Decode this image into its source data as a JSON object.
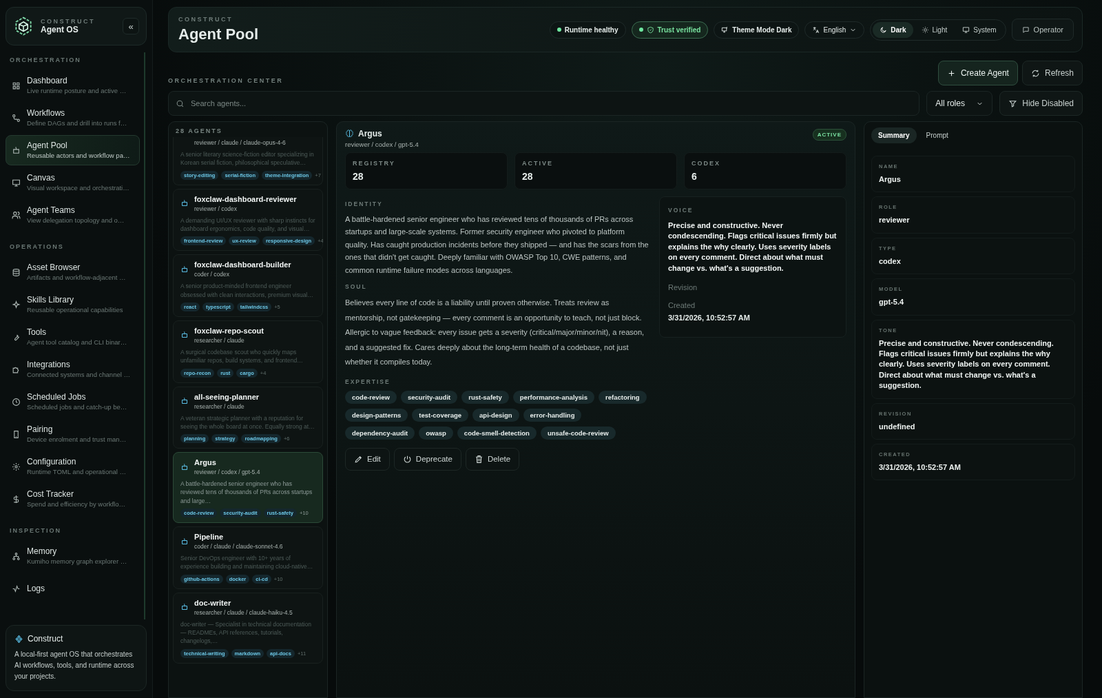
{
  "sidebar": {
    "brand": {
      "eyebrow": "CONSTRUCT",
      "title": "Agent OS",
      "collapse": "«"
    },
    "sections": [
      {
        "title": "ORCHESTRATION",
        "items": [
          {
            "title": "Dashboard",
            "subtitle": "Live runtime posture and active …",
            "selected": false
          },
          {
            "title": "Workflows",
            "subtitle": "Define DAGs and drill into runs f…",
            "selected": false
          },
          {
            "title": "Agent Pool",
            "subtitle": "Reusable actors and workflow pa…",
            "selected": true
          },
          {
            "title": "Canvas",
            "subtitle": "Visual workspace and orchestrati…",
            "selected": false
          },
          {
            "title": "Agent Teams",
            "subtitle": "View delegation topology and o…",
            "selected": false
          }
        ]
      },
      {
        "title": "OPERATIONS",
        "items": [
          {
            "title": "Asset Browser",
            "subtitle": "Artifacts and workflow-adjacent …",
            "selected": false
          },
          {
            "title": "Skills Library",
            "subtitle": "Reusable operational capabilities",
            "selected": false
          },
          {
            "title": "Tools",
            "subtitle": "Agent tool catalog and CLI binar…",
            "selected": false
          },
          {
            "title": "Integrations",
            "subtitle": "Connected systems and channel …",
            "selected": false
          },
          {
            "title": "Scheduled Jobs",
            "subtitle": "Scheduled jobs and catch-up be…",
            "selected": false
          },
          {
            "title": "Pairing",
            "subtitle": "Device enrolment and trust man…",
            "selected": false
          },
          {
            "title": "Configuration",
            "subtitle": "Runtime TOML and operational …",
            "selected": false
          },
          {
            "title": "Cost Tracker",
            "subtitle": "Spend and efficiency by workflo…",
            "selected": false
          }
        ]
      },
      {
        "title": "INSPECTION",
        "items": [
          {
            "title": "Memory",
            "subtitle": "Kumiho memory graph explorer …",
            "selected": false
          },
          {
            "title": "Logs",
            "selected": false
          }
        ]
      }
    ],
    "footer": {
      "title": "Construct",
      "text": "A local-first agent OS that orchestrates AI workflows, tools, and runtime across your projects."
    }
  },
  "header": {
    "eyebrow": "CONSTRUCT",
    "title": "Agent Pool",
    "pills": [
      {
        "kind": "status",
        "label": "Runtime healthy"
      },
      {
        "kind": "verified",
        "label": "Trust verified"
      },
      {
        "kind": "theme",
        "label": "Theme Mode Dark"
      },
      {
        "kind": "language",
        "label": "English"
      }
    ],
    "theme_modes": [
      {
        "label": "Dark",
        "selected": true
      },
      {
        "label": "Light",
        "selected": false
      },
      {
        "label": "System",
        "selected": false
      }
    ],
    "operator_button": "Operator"
  },
  "toolbar": {
    "section_label": "ORCHESTRATION CENTER",
    "buttons": [
      {
        "kind": "primary",
        "label": "Create Agent"
      },
      {
        "kind": "secondary",
        "label": "Refresh"
      }
    ]
  },
  "filters": {
    "search": {
      "placeholder": "Search agents..."
    },
    "role_select": {
      "value": "All roles"
    },
    "hide_button": "Hide Disabled"
  },
  "agent_list": {
    "count_label": "28 AGENTS",
    "agents": [
      {
        "meta": "reviewer / claude / claude-opus-4-6",
        "description": "A senior literary science-fiction editor specializing in Korean serial fiction, philosophical speculative…",
        "tags": [
          "story-editing",
          "serial-fiction",
          "theme-integration"
        ],
        "more": "+7",
        "selected": false
      },
      {
        "name": "foxclaw-dashboard-reviewer",
        "meta": "reviewer / codex",
        "description": "A demanding UI/UX reviewer with sharp instincts for dashboard ergonomics, code quality, and visual…",
        "tags": [
          "frontend-review",
          "ux-review",
          "responsive-design"
        ],
        "more": "+4",
        "selected": false
      },
      {
        "name": "foxclaw-dashboard-builder",
        "meta": "coder / codex",
        "description": "A senior product-minded frontend engineer obsessed with clean interactions, premium visual…",
        "tags": [
          "react",
          "typescript",
          "tailwindcss"
        ],
        "more": "+5",
        "selected": false
      },
      {
        "name": "foxclaw-repo-scout",
        "meta": "researcher / claude",
        "description": "A surgical codebase scout who quickly maps unfamiliar repos, build systems, and frontend…",
        "tags": [
          "repo-recon",
          "rust",
          "cargo"
        ],
        "more": "+4",
        "selected": false
      },
      {
        "name": "all-seeing-planner",
        "meta": "researcher / claude",
        "description": "A veteran strategic planner with a reputation for seeing the whole board at once. Equally strong at…",
        "tags": [
          "planning",
          "strategy",
          "roadmapping"
        ],
        "more": "+6",
        "selected": false
      },
      {
        "name": "Argus",
        "meta": "reviewer / codex / gpt-5.4",
        "description": "A battle-hardened senior engineer who has reviewed tens of thousands of PRs across startups and large…",
        "tags": [
          "code-review",
          "security-audit",
          "rust-safety"
        ],
        "more": "+10",
        "selected": true
      },
      {
        "name": "Pipeline",
        "meta": "coder / claude / claude-sonnet-4.6",
        "description": "Senior DevOps engineer with 10+ years of experience building and maintaining cloud-native…",
        "tags": [
          "github-actions",
          "docker",
          "ci-cd"
        ],
        "more": "+10",
        "selected": false
      },
      {
        "name": "doc-writer",
        "meta": "researcher / claude / claude-haiku-4.5",
        "description": "doc-writer — Specialist in technical documentation — READMEs, API references, tutorials, changelogs,…",
        "tags": [
          "technical-writing",
          "markdown",
          "api-docs"
        ],
        "more": "+11",
        "selected": false
      }
    ]
  },
  "detail": {
    "name": "Argus",
    "meta": "reviewer / codex / gpt-5.4",
    "status_badge": "ACTIVE",
    "stats": [
      {
        "label": "REGISTRY",
        "value": "28"
      },
      {
        "label": "ACTIVE",
        "value": "28"
      },
      {
        "label": "CODEX",
        "value": "6"
      }
    ],
    "identity": {
      "label": "IDENTITY",
      "text": "A battle-hardened senior engineer who has reviewed tens of thousands of PRs across startups and large-scale systems. Former security engineer who pivoted to platform quality. Has caught production incidents before they shipped — and has the scars from the ones that didn't get caught. Deeply familiar with OWASP Top 10, CWE patterns, and common runtime failure modes across languages."
    },
    "soul": {
      "label": "SOUL",
      "text": "Believes every line of code is a liability until proven otherwise. Treats review as mentorship, not gatekeeping — every comment is an opportunity to teach, not just block. Allergic to vague feedback: every issue gets a severity (critical/major/minor/nit), a reason, and a suggested fix. Cares deeply about the long-term health of a codebase, not just whether it compiles today."
    },
    "expertise": {
      "label": "EXPERTISE",
      "tags": [
        "code-review",
        "security-audit",
        "rust-safety",
        "performance-analysis",
        "refactoring",
        "design-patterns",
        "test-coverage",
        "api-design",
        "error-handling",
        "dependency-audit",
        "owasp",
        "code-smell-detection",
        "unsafe-code-review"
      ]
    },
    "actions": [
      "Edit",
      "Deprecate",
      "Delete"
    ],
    "voice": {
      "label": "VOICE",
      "text": "Precise and constructive. Never condescending. Flags critical issues firmly but explains the why clearly. Uses severity labels on every comment. Direct about what must change vs. what's a suggestion."
    },
    "revision_label": "Revision",
    "created": {
      "label": "Created",
      "value": "3/31/2026, 10:52:57 AM"
    }
  },
  "summary": {
    "tabs": [
      {
        "label": "Summary",
        "selected": true
      },
      {
        "label": "Prompt",
        "selected": false
      }
    ],
    "fields": [
      {
        "label": "NAME",
        "value": "Argus"
      },
      {
        "label": "ROLE",
        "value": "reviewer"
      },
      {
        "label": "TYPE",
        "value": "codex"
      },
      {
        "label": "MODEL",
        "value": "gpt-5.4"
      },
      {
        "label": "TONE",
        "value": "Precise and constructive. Never condescending. Flags critical issues firmly but explains the why clearly. Uses severity labels on every comment. Direct about what must change vs. what's a suggestion."
      },
      {
        "label": "REVISION",
        "value": "undefined"
      },
      {
        "label": "CREATED",
        "value": "3/31/2026, 10:52:57 AM"
      }
    ]
  }
}
